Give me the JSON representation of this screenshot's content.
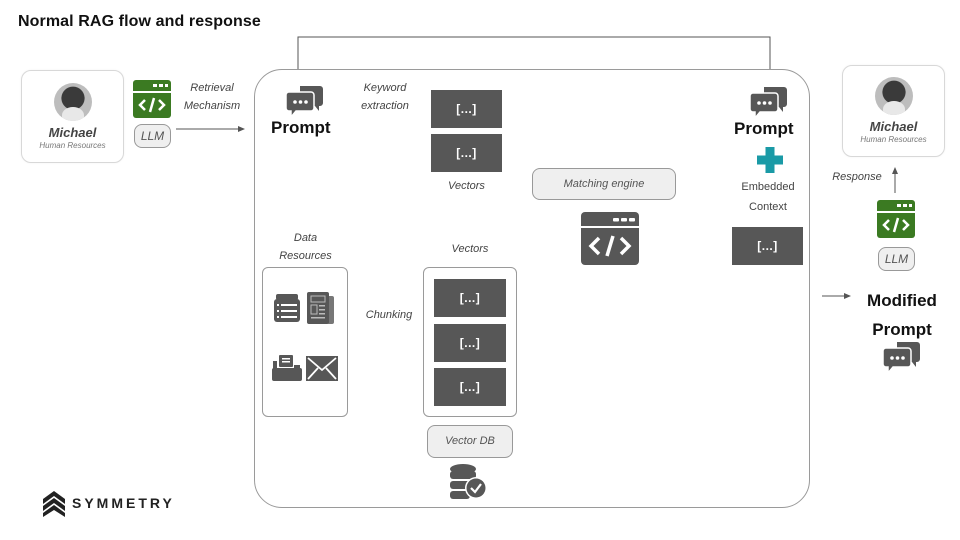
{
  "title": "Normal RAG flow and response",
  "user_card": {
    "name": "Michael",
    "role": "Human Resources"
  },
  "left_llm": {
    "label": "Retrieval Mechanism",
    "label_line1": "Retrieval",
    "label_line2": "Mechanism",
    "pill": "LLM"
  },
  "main": {
    "prompt_label": "Prompt",
    "keyword_line1": "Keyword",
    "keyword_line2": "extraction",
    "query_vectors": [
      "[...]",
      "[...]"
    ],
    "query_vectors_label": "Vectors",
    "matching_engine": "Matching engine",
    "data_resources_line1": "Data",
    "data_resources_line2": "Resources",
    "chunking_label": "Chunking",
    "db_vectors_label": "Vectors",
    "db_vectors": [
      "[...]",
      "[...]",
      "[...]"
    ],
    "vector_db": "Vector DB",
    "right_prompt_label": "Prompt",
    "embedded_line1": "Embedded",
    "embedded_line2": "Context",
    "context_vector": "[...]"
  },
  "right": {
    "card_name": "Michael",
    "card_role": "Human Resources",
    "response_label": "Response",
    "llm_pill": "LLM",
    "modified_line1": "Modified",
    "modified_line2": "Prompt"
  },
  "brand": {
    "name": "SYMMETRY"
  },
  "colors": {
    "llm_green": "#3b7a22",
    "dark_gray": "#575757",
    "teal_plus": "#1a9aa6"
  }
}
